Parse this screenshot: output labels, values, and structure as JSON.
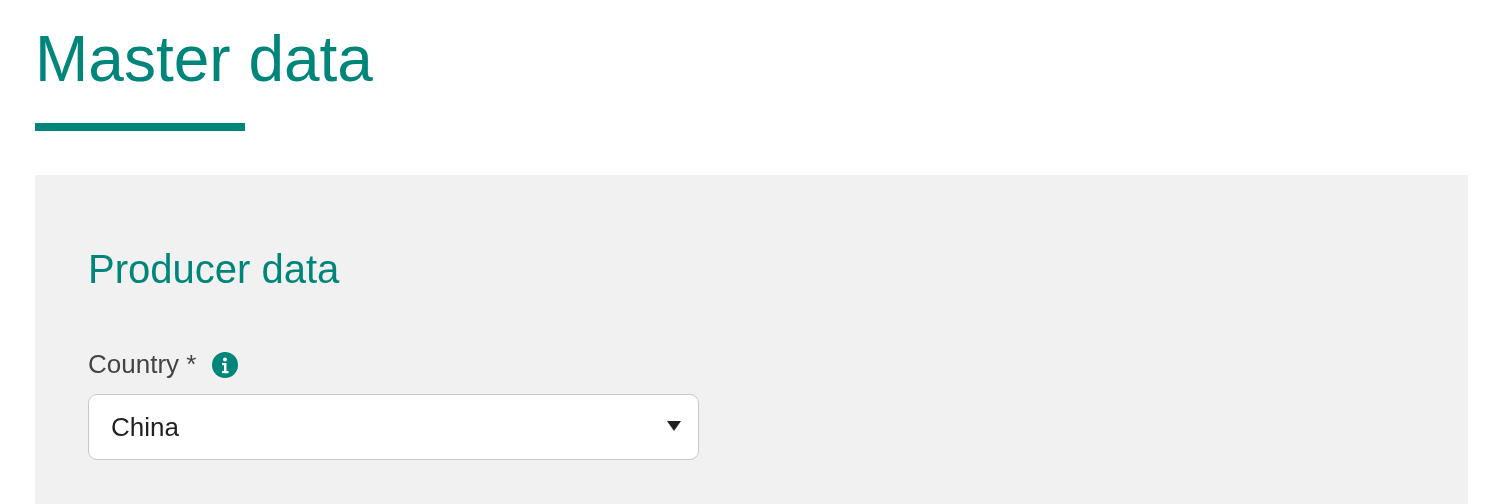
{
  "page": {
    "title": "Master data"
  },
  "section": {
    "title": "Producer data",
    "fields": [
      {
        "kind": "select",
        "label": "Country *",
        "info": true,
        "value": "China"
      }
    ]
  }
}
